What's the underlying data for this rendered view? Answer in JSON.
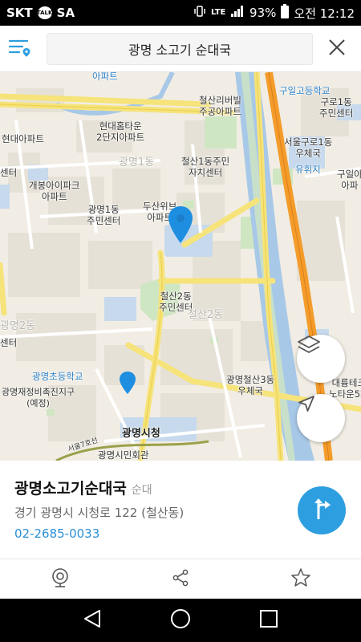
{
  "status_bar": {
    "carrier": "SKT",
    "talk_badge": "TALK",
    "sa": "SA",
    "battery": "93%",
    "time": "오전 12:12"
  },
  "search": {
    "query": "광명 소고기 순대국"
  },
  "map": {
    "labels": {
      "apt_top": "아파트",
      "cheolsan_rivervil": "철산리버빌\n주공아파트",
      "guil_high": "구일고등학교",
      "guro1_center": "구로1동\n주민센터",
      "hyundai_apt": "현대아파트",
      "hyundai_hometown": "현대홈타운\n2단지아파트",
      "seoul_guro_post": "서울구로1동\n우체국",
      "yuhaeji": "유휘지",
      "guil_apt": "구일아\n아파",
      "cheolsan1_center": "철산1동주민\n자치센터",
      "gaebong_apt": "개봉아이파크\n아파트",
      "gwangmyeong1_dong": "광명1동",
      "doosan_apt": "두산위브\n아파트",
      "gwangmyeong1_center": "광명1동\n주민센터",
      "cheolsan2_center": "철산2동\n주민센터",
      "gwangmyeong2_dong": "광명2동",
      "cheolsan2_dong": "철산2동",
      "gwangmyeong_elem": "광명초등학교",
      "gwangmyeong_redev": "광명재정비촉진지구\n(예정)",
      "cheolsan3_post": "광명철산3동\n우체국",
      "gwangmyeong_cityhall": "광명시청",
      "cityhall_annex": "광명시민회관",
      "daeryung": "대륭테크\n노타운5차",
      "ce_left": "센터",
      "ce_left2": "센터",
      "seoul_line": "서울7호선"
    }
  },
  "place": {
    "name": "광명소고기순대국",
    "category": "순대",
    "address": "경기 광명시 시청로 122  (철산동)",
    "phone": "02-2685-0033"
  },
  "icons": {
    "menu": "menu-location-icon",
    "close": "close-icon",
    "layers": "layers-icon",
    "locate": "navigation-arrow-icon",
    "route": "directions-icon",
    "roadview": "roadview-camera-icon",
    "share": "share-icon",
    "favorite": "star-icon",
    "back": "back-triangle-icon",
    "home": "home-circle-icon",
    "recent": "recent-square-icon"
  },
  "colors": {
    "accent": "#2d9ee0",
    "marker": "#1e8fe0",
    "river": "#a8c8e8",
    "highway": "#f39c2b",
    "park": "#cfe6c2"
  }
}
